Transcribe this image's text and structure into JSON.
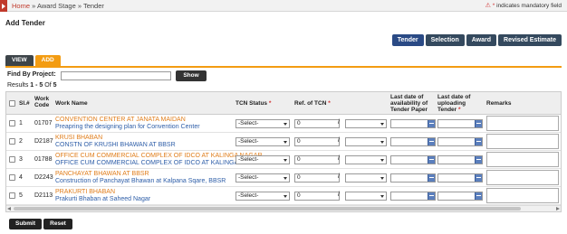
{
  "breadcrumb": {
    "home": "Home",
    "sep1": " » ",
    "stage": "Award Stage",
    "sep2": " » ",
    "current": "Tender"
  },
  "mandatory_note": {
    "star": "*",
    "text": " indicates mandatory field",
    "icon": "warning-icon"
  },
  "page_title": "Add Tender",
  "top_tabs": [
    "Tender",
    "Selection",
    "Award",
    "Revised Estimate"
  ],
  "mode_tabs": {
    "view": "VIEW",
    "add": "ADD"
  },
  "find": {
    "label": "Find By Project:",
    "value": "",
    "button": "Show"
  },
  "results": {
    "prefix": "Results ",
    "range": "1 - 5",
    "of": " Of ",
    "total": "5"
  },
  "columns": {
    "sl": "Sl.#",
    "code": "Work Code",
    "name": "Work Name",
    "tcn": "TCN Status",
    "ref": "Ref. of TCN",
    "avail": "Last date of availability of Tender Paper",
    "upload": "Last date of uploading Tender",
    "remarks": "Remarks",
    "required_mark": "*"
  },
  "rows": [
    {
      "sl": "1",
      "code": "01707",
      "title": "CONVENTION CENTER AT JANATA MAIDAN",
      "desc": "Preapring the designing plan for Convention Center",
      "tcn": "-Select-",
      "ref": "0"
    },
    {
      "sl": "2",
      "code": "D2187",
      "title": "KRUSI BHABAN",
      "desc": "CONSTN OF KRUSHI BHAWAN AT BBSR",
      "tcn": "-Select-",
      "ref": "0"
    },
    {
      "sl": "3",
      "code": "01788",
      "title": "OFFICE CUM COMMERCIAL COMPLEX OF IDCO AT KALINGA NAGAR",
      "desc": "OFFICE CUM COMMERCIAL COMPLEX OF IDCO AT KALINGA NAGAR",
      "tcn": "-Select-",
      "ref": "0"
    },
    {
      "sl": "4",
      "code": "D2243",
      "title": "PANCHAYAT BHAWAN AT BBSR",
      "desc": "Construction of Panchayat Bhawan at Kalpana Sqare, BBSR",
      "tcn": "-Select-",
      "ref": "0"
    },
    {
      "sl": "5",
      "code": "D2113",
      "title": "PRAKURTI BHABAN",
      "desc": "Prakurti Bhaban at Saheed Nagar",
      "tcn": "-Select-",
      "ref": "0"
    }
  ],
  "actions": {
    "submit": "Submit",
    "reset": "Reset"
  },
  "colors": {
    "accent": "#f39c12",
    "brand": "#c0392b",
    "title_link": "#e07d1a",
    "desc_link": "#2e5ea8",
    "tab": "#34495e"
  }
}
